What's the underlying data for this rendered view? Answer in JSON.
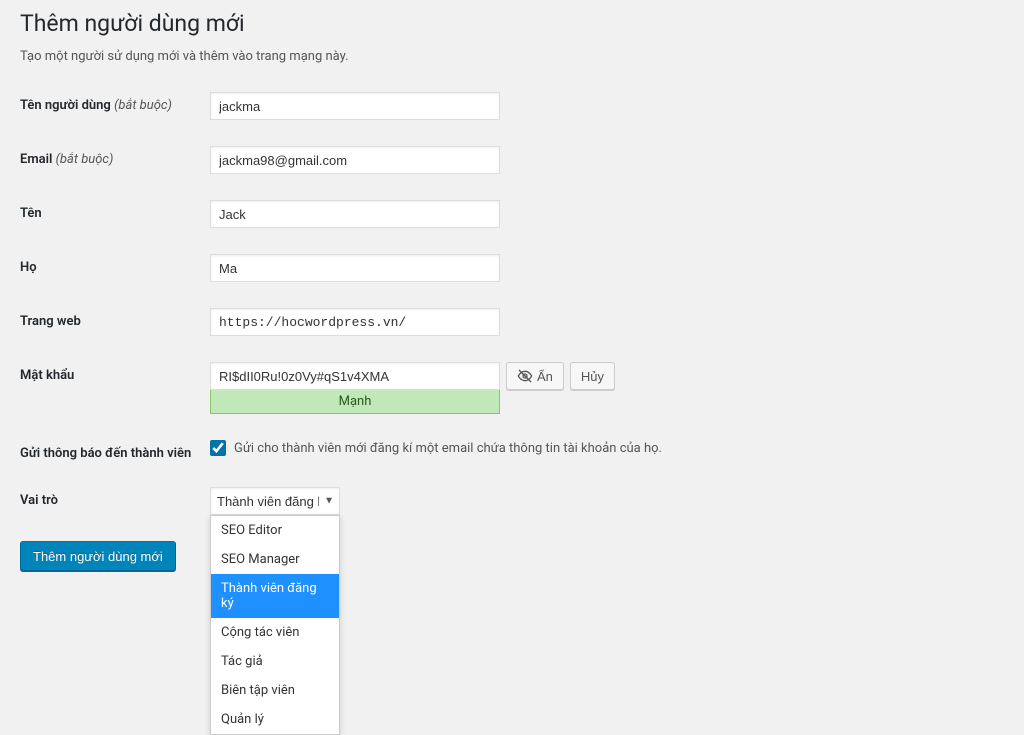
{
  "page": {
    "title": "Thêm người dùng mới",
    "description": "Tạo một người sử dụng mới và thêm vào trang mạng này."
  },
  "labels": {
    "username": "Tên người dùng",
    "email": "Email",
    "firstname": "Tên",
    "lastname": "Họ",
    "website": "Trang web",
    "password": "Mật khẩu",
    "notify": "Gửi thông báo đến thành viên",
    "role": "Vai trò",
    "required": "(bắt buộc)"
  },
  "values": {
    "username": "jackma",
    "email": "jackma98@gmail.com",
    "firstname": "Jack",
    "lastname": "Ma",
    "website": "https://hocwordpress.vn/",
    "password": "RI$dII0Ru!0z0Vy#qS1v4XMA",
    "notify_checked": true,
    "role_selected": "Thành viên đăng ký"
  },
  "password_strength": "Mạnh",
  "buttons": {
    "hide": "Ẩn",
    "cancel": "Hủy",
    "submit": "Thêm người dùng mới"
  },
  "notify_label": "Gửi cho thành viên mới đăng kí một email chứa thông tin tài khoản của họ.",
  "role_options": [
    "SEO Editor",
    "SEO Manager",
    "Thành viên đăng ký",
    "Cộng tác viên",
    "Tác giả",
    "Biên tập viên",
    "Quản lý"
  ]
}
